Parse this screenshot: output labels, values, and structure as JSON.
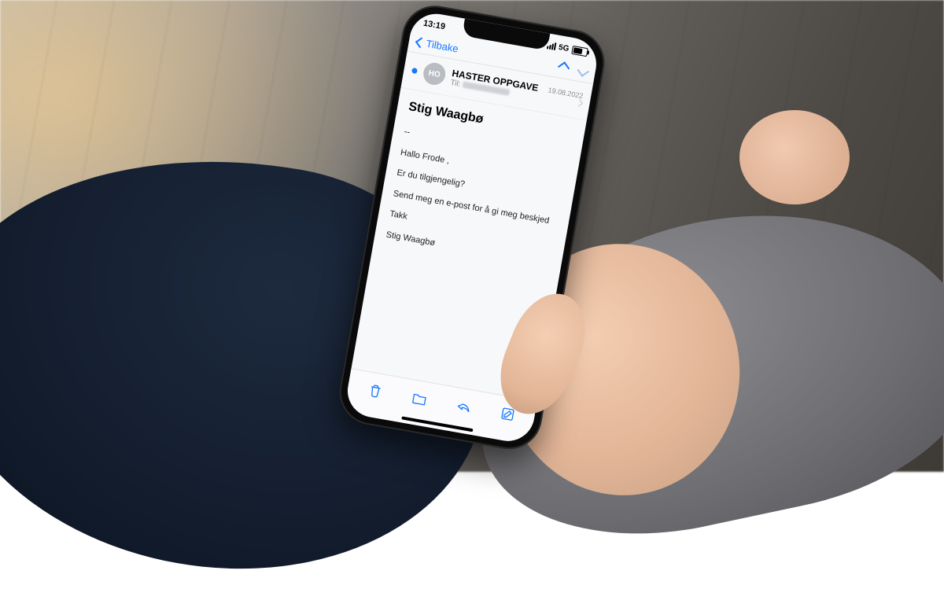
{
  "statusbar": {
    "time": "13:19",
    "network": "5G"
  },
  "nav": {
    "back_label": "Tilbake"
  },
  "header": {
    "avatar_initials": "HO",
    "subject": "HASTER OPPGAVE",
    "to_label": "Til:",
    "date": "19.08.2022"
  },
  "message": {
    "sender_name": "Stig Waagbø",
    "divider": "--",
    "greeting": "Hallo Frode ,",
    "line1": "Er du tilgjengelig?",
    "line2": "Send meg en e-post for å gi meg beskjed",
    "thanks": "Takk",
    "signature": "Stig Waagbø"
  }
}
